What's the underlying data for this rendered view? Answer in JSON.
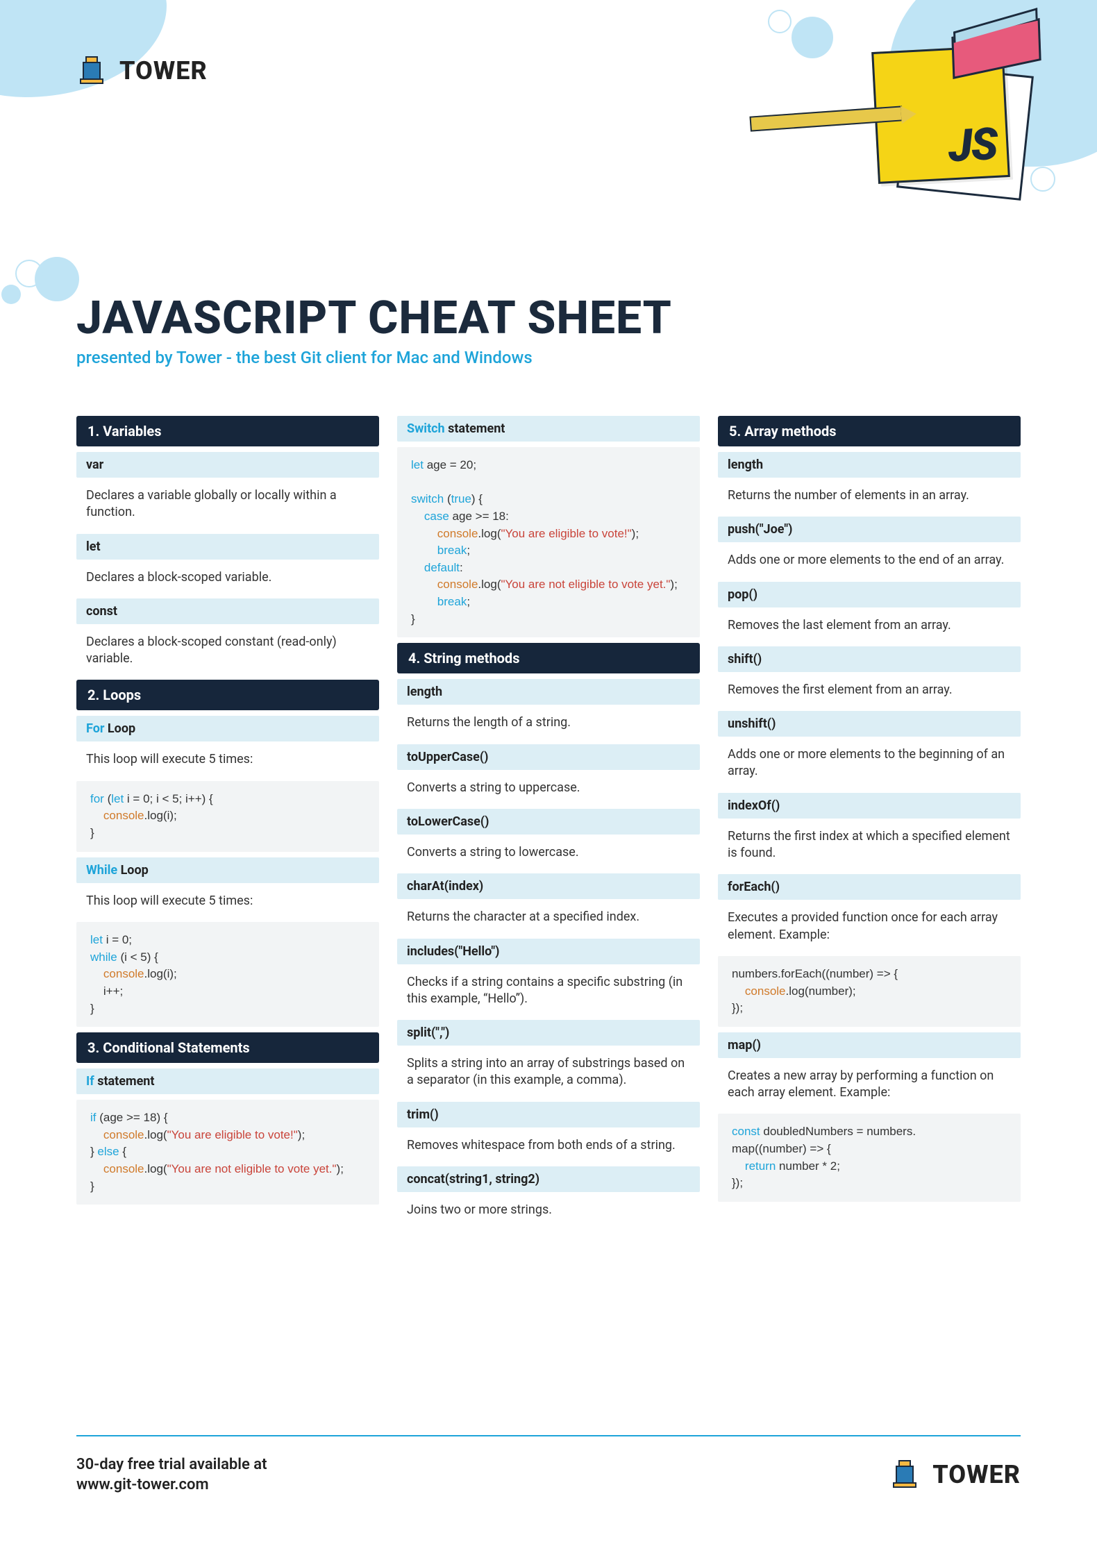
{
  "brand": {
    "name": "TOWER"
  },
  "illustration": {
    "label": "JS"
  },
  "header": {
    "title": "JAVASCRIPT CHEAT SHEET",
    "subtitle": "presented by Tower - the best Git client for Mac and Windows"
  },
  "sections": {
    "s1": {
      "title": "1. Variables",
      "items": {
        "var": {
          "h": "var",
          "d": "Declares a variable globally or locally within a function."
        },
        "let": {
          "h": "let",
          "d": "Declares a block-scoped variable."
        },
        "const": {
          "h": "const",
          "d": "Declares a block-scoped constant (read-only) variable."
        }
      }
    },
    "s2": {
      "title": "2. Loops",
      "for": {
        "h_accent": "For",
        "h_rest": " Loop",
        "d": "This loop will execute 5 times:"
      },
      "while": {
        "h_accent": "While",
        "h_rest": " Loop",
        "d": "This loop will execute 5 times:"
      },
      "code_for": {
        "l1a": "for",
        "l1b": " (",
        "l1c": "let",
        "l1d": " i = 0; i < 5; i++) {",
        "l2a": "console",
        "l2b": ".log(i);",
        "l3": "}"
      },
      "code_while": {
        "l1a": "let",
        "l1b": " i = 0;",
        "l2a": "while",
        "l2b": " (i < 5) {",
        "l3a": "console",
        "l3b": ".log(i);",
        "l4": "i++;",
        "l5": "}"
      }
    },
    "s3": {
      "title": "3. Conditional Statements",
      "if": {
        "h_accent": "If",
        "h_rest": " statement"
      },
      "code_if": {
        "l1a": "if",
        "l1b": " (age >= 18) {",
        "l2a": "console",
        "l2b": ".log(",
        "l2c": "\"You are eligible to vote!\"",
        "l2d": ");",
        "l3a": "} ",
        "l3b": "else",
        "l3c": " {",
        "l4a": "console",
        "l4b": ".log(",
        "l4c": "\"You are not eligible to vote yet.\"",
        "l4d": ");",
        "l5": "}"
      },
      "switch": {
        "h_accent": "Switch",
        "h_rest": " statement"
      },
      "code_switch": {
        "l1a": "let",
        "l1b": " age = 20;",
        "blank": "",
        "l2a": "switch",
        "l2b": " (",
        "l2c": "true",
        "l2d": ") {",
        "l3a": "case",
        "l3b": " age >= 18:",
        "l4a": "console",
        "l4b": ".log(",
        "l4c": "\"You are eligible to vote!\"",
        "l4d": ");",
        "l5a": "break",
        "l5b": ";",
        "l6a": "default",
        "l6b": ":",
        "l7a": "console",
        "l7b": ".log(",
        "l7c": "\"You are not eligible to vote yet.\"",
        "l7d": ");",
        "l8a": "break",
        "l8b": ";",
        "l9": "}"
      }
    },
    "s4": {
      "title": "4. String methods",
      "items": {
        "length": {
          "h": "length",
          "d": "Returns the length of a string."
        },
        "upper": {
          "h": "toUpperCase()",
          "d": "Converts a string to uppercase."
        },
        "lower": {
          "h": "toLowerCase()",
          "d": "Converts a string to lowercase."
        },
        "charat": {
          "h": "charAt(index)",
          "d": "Returns the character at a specified index."
        },
        "includes": {
          "h": "includes(\"Hello\")",
          "d": "Checks if a string contains a specific substring (in this example, “Hello”)."
        },
        "split": {
          "h": "split(\",\")",
          "d": "Splits a string into an array of substrings based on a separator (in this example, a comma)."
        },
        "trim": {
          "h": "trim()",
          "d": "Removes whitespace from both ends of a string."
        },
        "concat": {
          "h": "concat(string1, string2)",
          "d": "Joins two or more strings."
        }
      }
    },
    "s5": {
      "title": "5. Array methods",
      "items": {
        "length": {
          "h": "length",
          "d": "Returns the number of elements in an array."
        },
        "push": {
          "h": "push(\"Joe\")",
          "d": "Adds one or more elements to the end of an array."
        },
        "pop": {
          "h": "pop()",
          "d": "Removes the last element from an array."
        },
        "shift": {
          "h": "shift()",
          "d": "Removes the first element from an array."
        },
        "unshift": {
          "h": "unshift()",
          "d": "Adds one or more elements to the beginning of an array."
        },
        "indexof": {
          "h": "indexOf()",
          "d": "Returns the first index at which a specified element is found."
        },
        "foreach": {
          "h": "forEach()",
          "d": "Executes a provided function once for each array element. Example:"
        },
        "map": {
          "h": "map()",
          "d": "Creates a new array by performing a function on each array element. Example:"
        }
      },
      "code_foreach": {
        "l1": "numbers.forEach((number) => {",
        "l2a": "console",
        "l2b": ".log(number);",
        "l3": "});"
      },
      "code_map": {
        "l1a": "const",
        "l1b": " doubledNumbers = numbers.",
        "l2": "map((number) => {",
        "l3a": "return",
        "l3b": " number * 2;",
        "l4": "});"
      }
    }
  },
  "footer": {
    "trial_line1": "30-day free trial available at",
    "trial_line2": "www.git-tower.com",
    "brand": "TOWER"
  }
}
